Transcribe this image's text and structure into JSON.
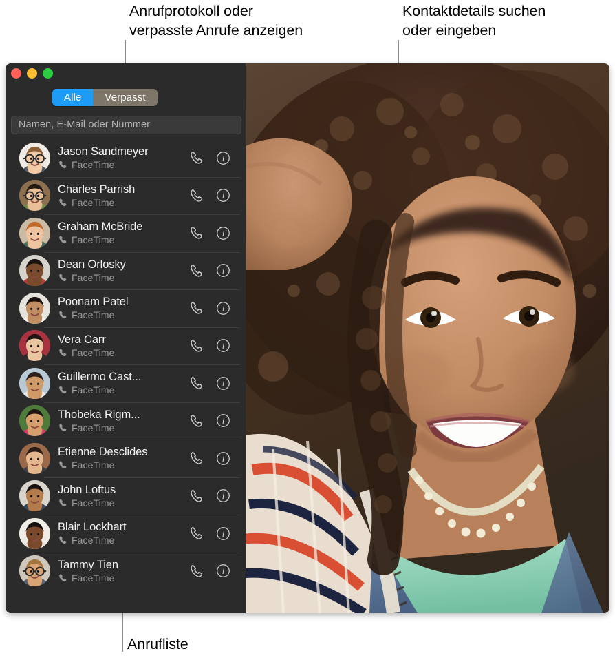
{
  "annotations": {
    "top_left": "Anrufprotokoll oder\nverpasste Anrufe anzeigen",
    "top_right": "Kontaktdetails suchen\noder eingeben",
    "bottom": "Anrufliste"
  },
  "window": {
    "traffic_lights": [
      {
        "name": "close",
        "color": "#ff6159"
      },
      {
        "name": "minimize",
        "color": "#ffbe2f"
      },
      {
        "name": "zoom",
        "color": "#2ace42"
      }
    ]
  },
  "segmented_control": {
    "selected": "Alle",
    "options": [
      {
        "label": "Alle",
        "selected": true,
        "color": "#1e9bf5"
      },
      {
        "label": "Verpasst",
        "selected": false,
        "color": "#7d7669"
      }
    ]
  },
  "search": {
    "value": "",
    "placeholder": "Namen, E-Mail oder Nummer"
  },
  "call_list": {
    "rows": [
      {
        "name": "Jason Sandmeyer",
        "service": "FaceTime"
      },
      {
        "name": "Charles Parrish",
        "service": "FaceTime"
      },
      {
        "name": "Graham McBride",
        "service": "FaceTime"
      },
      {
        "name": "Dean Orlosky",
        "service": "FaceTime"
      },
      {
        "name": "Poonam Patel",
        "service": "FaceTime"
      },
      {
        "name": "Vera Carr",
        "service": "FaceTime"
      },
      {
        "name": "Guillermo Cast...",
        "service": "FaceTime"
      },
      {
        "name": "Thobeka Rigm...",
        "service": "FaceTime"
      },
      {
        "name": "Etienne Desclides",
        "service": "FaceTime"
      },
      {
        "name": "John Loftus",
        "service": "FaceTime"
      },
      {
        "name": "Blair Lockhart",
        "service": "FaceTime"
      },
      {
        "name": "Tammy Tien",
        "service": "FaceTime"
      }
    ],
    "row_icons": {
      "call": "phone-handset-icon",
      "info": "info-circle-icon",
      "service": "phone-handset-small-icon"
    }
  },
  "video_panel": {
    "description": "smiling-woman-portrait"
  },
  "colors": {
    "window_background": "#2b2b2b",
    "accent": "#1e9bf5",
    "segment_inactive": "#7d7669",
    "name_text": "#f2f2f2",
    "sub_text": "#9a9a9a",
    "separator": "#3d3d3d",
    "callout_line": "#8c8c8c",
    "annotation_text": "#000000"
  }
}
